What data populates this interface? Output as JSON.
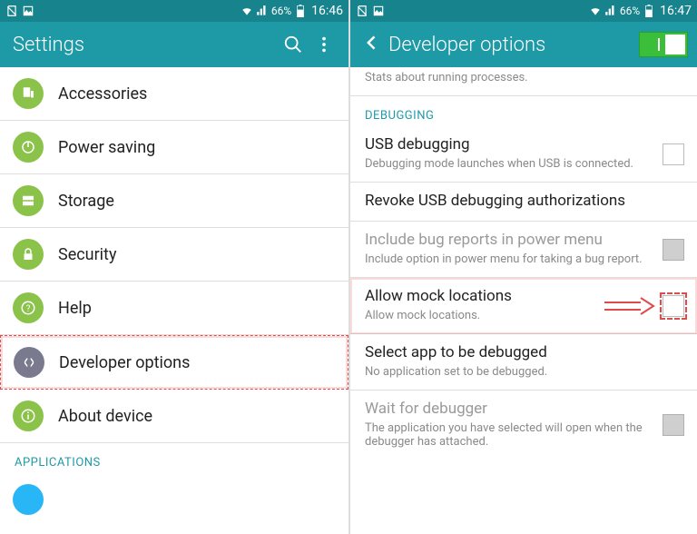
{
  "left": {
    "statusbar": {
      "battery_pct": "66%",
      "time": "16:46"
    },
    "appbar": {
      "title": "Settings"
    },
    "items": [
      {
        "name": "accessories",
        "label": "Accessories"
      },
      {
        "name": "power-saving",
        "label": "Power saving"
      },
      {
        "name": "storage",
        "label": "Storage"
      },
      {
        "name": "security",
        "label": "Security"
      },
      {
        "name": "help",
        "label": "Help"
      },
      {
        "name": "developer-options",
        "label": "Developer options"
      },
      {
        "name": "about-device",
        "label": "About device"
      }
    ],
    "section_header": "APPLICATIONS"
  },
  "right": {
    "statusbar": {
      "battery_pct": "66%",
      "time": "16:47"
    },
    "appbar": {
      "title": "Developer options"
    },
    "partial_top_sub": "Stats about running processes.",
    "section_debugging": "DEBUGGING",
    "rows": [
      {
        "name": "usb-debugging",
        "title": "USB debugging",
        "sub": "Debugging mode launches when USB is connected.",
        "checkbox": true
      },
      {
        "name": "revoke-usb",
        "title": "Revoke USB debugging authorizations",
        "sub": ""
      },
      {
        "name": "include-bug-reports",
        "title": "Include bug reports in power menu",
        "sub": "Include option in power menu for taking a bug report.",
        "disabled": true,
        "checkbox": true,
        "dim": true
      },
      {
        "name": "allow-mock-locations",
        "title": "Allow mock locations",
        "sub": "Allow mock locations.",
        "checkbox": true,
        "highlight": true
      },
      {
        "name": "select-app-debug",
        "title": "Select app to be debugged",
        "sub": "No application set to be debugged."
      },
      {
        "name": "wait-for-debugger",
        "title": "Wait for debugger",
        "sub": "The application you have selected will open when the debugger has attached.",
        "disabled": true,
        "checkbox": true,
        "dim": true
      }
    ]
  }
}
